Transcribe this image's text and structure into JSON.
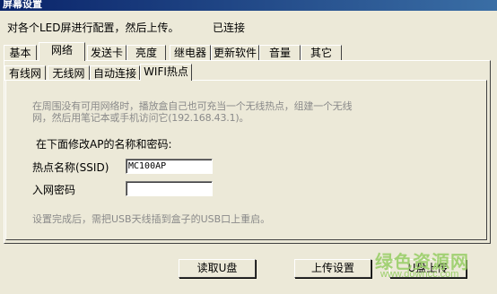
{
  "window": {
    "title": "屏幕设置"
  },
  "header": {
    "description": "对各个LED屏进行配置，然后上传。",
    "status": "已连接"
  },
  "tabs": [
    {
      "label": "基本"
    },
    {
      "label": "网络"
    },
    {
      "label": "发送卡"
    },
    {
      "label": "亮度"
    },
    {
      "label": "继电器"
    },
    {
      "label": "更新软件"
    },
    {
      "label": "音量"
    },
    {
      "label": "其它"
    }
  ],
  "active_tab": "网络",
  "subtabs": [
    {
      "label": "有线网"
    },
    {
      "label": "无线网"
    },
    {
      "label": "自动连接"
    },
    {
      "label": "WIFI热点"
    }
  ],
  "active_subtab": "WIFI热点",
  "wifi": {
    "hint": "在周围没有可用网络时，播放盒自己也可充当一个无线热点，组建一个无线网，然后用笔记本或手机访问它(192.168.43.1)。",
    "form_title": "在下面修改AP的名称和密码:",
    "ssid_label": "热点名称(SSID)",
    "ssid_value": "MC100AP",
    "password_label": "入网密码",
    "password_value": "",
    "note": "设置完成后，需把USB天线插到盒子的USB口上重启。"
  },
  "buttons": {
    "read_u": "读取U盘",
    "upload_settings": "上传设置",
    "u_upload": "U盘上传"
  },
  "watermark": {
    "text": "绿色资源网",
    "url": "www.downcc.com"
  }
}
